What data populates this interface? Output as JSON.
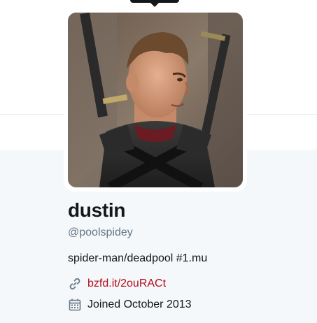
{
  "profile": {
    "name": "dustin",
    "handle": "@poolspidey",
    "bio": "spider-man/deadpool #1.mu",
    "link": "bzfd.it/2ouRACt",
    "joined": "Joined October 2013"
  },
  "colors": {
    "link": "#b30d1e",
    "secondary_text": "#657786",
    "content_bg": "#f5f8fa"
  },
  "icons": {
    "link": "link-icon",
    "calendar": "calendar-icon"
  }
}
